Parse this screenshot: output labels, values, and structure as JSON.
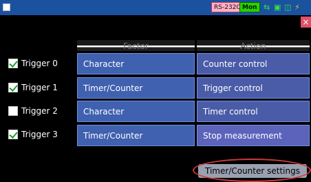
{
  "topbar": {
    "rs_label": "RS-232C",
    "mon_label": "Mon"
  },
  "columns": {
    "factor": "Factor",
    "action": "Action"
  },
  "rows": [
    {
      "trigger": "Trigger 0",
      "checked": true,
      "factor": "Character",
      "action": "Counter control"
    },
    {
      "trigger": "Trigger 1",
      "checked": true,
      "factor": "Timer/Counter",
      "action": "Trigger control"
    },
    {
      "trigger": "Trigger 2",
      "checked": false,
      "factor": "Character",
      "action": "Timer control"
    },
    {
      "trigger": "Trigger 3",
      "checked": true,
      "factor": "Timer/Counter",
      "action": "Stop measurement"
    }
  ],
  "close_glyph": "×",
  "settings_button": "Timer/Counter settings",
  "colors": {
    "topbar": "#1a52a0",
    "cell": "#4060b0",
    "highlight": "#d03a3a",
    "mon": "#28d000"
  }
}
